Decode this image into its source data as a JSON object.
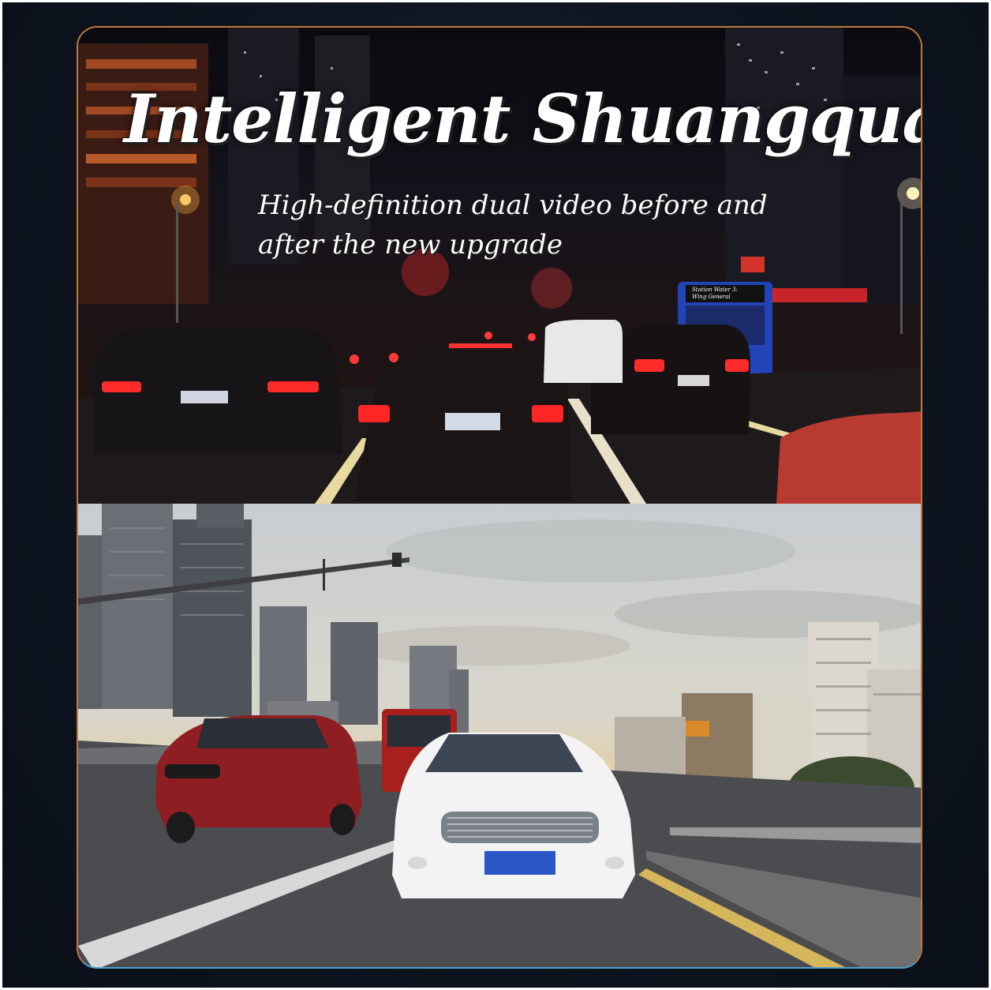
{
  "banner": {
    "title": "Intelligent Shuangquan",
    "subtitle": "High-definition dual video before and after the new upgrade"
  },
  "scenes": {
    "front_view": "night city traffic",
    "rear_view": "daytime city road"
  },
  "bus_sign": "Station Water 3: Wing General",
  "colors": {
    "frame_bg": "#0d141f",
    "panel_border_top": "#c07a3a",
    "panel_border_bottom": "#4aa3d8",
    "title_text": "#ffffff"
  }
}
